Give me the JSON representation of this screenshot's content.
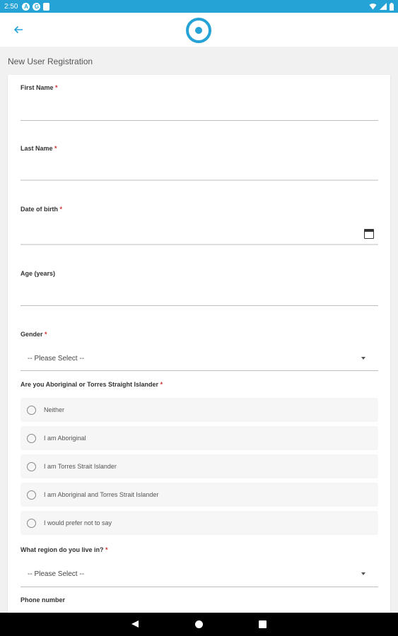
{
  "status_bar": {
    "time": "2:50",
    "icons": [
      "A",
      "G"
    ],
    "right_icons": [
      "wifi-icon",
      "signal-icon",
      "battery-icon"
    ],
    "color": "#26a3d6"
  },
  "app_bar": {
    "back_icon": "arrow-left-icon",
    "logo": "circle-logo",
    "accent": "#26a3d6"
  },
  "page": {
    "title": "New User Registration"
  },
  "form": {
    "first_name": {
      "label": "First Name",
      "required": "*",
      "value": ""
    },
    "last_name": {
      "label": "Last Name",
      "required": "*",
      "value": ""
    },
    "dob": {
      "label": "Date of birth",
      "required": "*",
      "value": "",
      "icon": "calendar-icon"
    },
    "age": {
      "label": "Age (years)",
      "value": ""
    },
    "gender": {
      "label": "Gender",
      "required": "*",
      "selected": "-- Please Select --"
    },
    "indigenous": {
      "label": "Are you Aboriginal or Torres Straight Islander",
      "required": "*",
      "options": [
        {
          "label": "Neither"
        },
        {
          "label": "I am Aboriginal"
        },
        {
          "label": "I am Torres Strait Islander"
        },
        {
          "label": "I am Aboriginal and Torres Strait Islander"
        },
        {
          "label": "I would prefer not to say"
        }
      ]
    },
    "region": {
      "label": "What region do you live in?",
      "required": "*",
      "selected": "-- Please Select --"
    },
    "phone": {
      "label": "Phone number"
    }
  },
  "nav_bar": {
    "icons": [
      "back-icon",
      "home-icon",
      "recents-icon"
    ]
  }
}
